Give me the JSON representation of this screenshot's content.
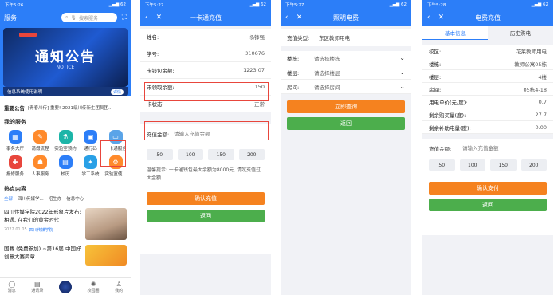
{
  "p1": {
    "time": "下午5:26",
    "signal": "▂▄▆ 62",
    "app_title": "服务",
    "search_placeholder": "搜索服务",
    "banner_title": "通知公告",
    "banner_subtitle": "NOTICE",
    "banner_caption": "信息系统使用说明",
    "banner_tag": "详情",
    "news_label": "重要公告",
    "news_text": "[青春川传] 重要! 2021级川传新生团员团...",
    "my_services_title": "我的服务",
    "services": [
      {
        "label": "事务大厅",
        "icon": "▦",
        "color": "#2c7ef8"
      },
      {
        "label": "请假流程",
        "icon": "✎",
        "color": "#ff8a2b"
      },
      {
        "label": "实验室预约",
        "icon": "⚗",
        "color": "#1cb5a8"
      },
      {
        "label": "通行码",
        "icon": "▣",
        "color": "#2c7ef8"
      },
      {
        "label": "一卡通服务",
        "icon": "▭",
        "color": "#5aa4e8"
      },
      {
        "label": "报修服务",
        "icon": "✚",
        "color": "#e8463c"
      },
      {
        "label": "人事服务",
        "icon": "☗",
        "color": "#ff8a2b"
      },
      {
        "label": "校历",
        "icon": "▤",
        "color": "#2c7ef8"
      },
      {
        "label": "学工系统",
        "icon": "✦",
        "color": "#29a0e6"
      },
      {
        "label": "实验室使...",
        "icon": "⚙",
        "color": "#ff8a2b"
      }
    ],
    "hot_title": "热点内容",
    "hot_tabs": [
      "全部",
      "四川传媒学...",
      "招生办",
      "信息中心"
    ],
    "article1_title": "四川传媒学院2022年形象片发布: 相遇, 在我们的黄金时代",
    "article1_date": "2022.01.05",
    "article1_source": "四川传媒学院",
    "article2_title": "国赛 (免费参加) ~第16届 中国好创意大赛简章",
    "bottom_nav": [
      {
        "label": "消息",
        "icon": "◯"
      },
      {
        "label": "通讯录",
        "icon": "▤"
      },
      {
        "label": "",
        "icon": "●"
      },
      {
        "label": "校园圈",
        "icon": "✺"
      },
      {
        "label": "我的",
        "icon": "♙"
      }
    ]
  },
  "p2": {
    "time": "下午5:27",
    "signal": "▂▄▆ 62",
    "title": "一卡通充值",
    "rows": [
      {
        "label": "姓名:",
        "value": "杨铮强"
      },
      {
        "label": "学号:",
        "value": "310676"
      },
      {
        "label": "卡钱包余额:",
        "value": "1223.07"
      },
      {
        "label": "未领取余额:",
        "value": "150"
      },
      {
        "label": "卡状态:",
        "value": "正常"
      }
    ],
    "amount_label": "充值金额:",
    "amount_placeholder": "请输入充值金额",
    "chips": [
      "50",
      "100",
      "150",
      "200"
    ],
    "hint": "温馨提示: 一卡通钱包最大余额为8000元, 请勿充值过大金额",
    "confirm": "确认充值",
    "back": "返回"
  },
  "p3": {
    "time": "下午5:27",
    "signal": "▂▄▆ 62",
    "title": "照明电费",
    "type_label": "充值类型:",
    "type_value": "东区教师用电",
    "selects": [
      {
        "label": "楼栋:",
        "placeholder": "请选择楼栋"
      },
      {
        "label": "楼层:",
        "placeholder": "请选择楼层"
      },
      {
        "label": "房间:",
        "placeholder": "请选择房间"
      }
    ],
    "query": "立即查询",
    "back": "返回"
  },
  "p4": {
    "time": "下午5:28",
    "signal": "▂▄▆ 62",
    "title": "电费充值",
    "tabs": [
      "基本信息",
      "历史购电"
    ],
    "rows": [
      {
        "label": "校区:",
        "value": "花莱教师用电"
      },
      {
        "label": "楼栋:",
        "value": "教师公寓05栋"
      },
      {
        "label": "楼层:",
        "value": "4楼"
      },
      {
        "label": "房间:",
        "value": "05栋4-18"
      },
      {
        "label": "用电单价(元/度):",
        "value": "0.7"
      },
      {
        "label": "剩余购买量(度):",
        "value": "27.7"
      },
      {
        "label": "剩余补助电量(度):",
        "value": "0.00"
      }
    ],
    "amount_label": "充值金额:",
    "amount_placeholder": "请输入充值金额",
    "chips": [
      "50",
      "100",
      "150",
      "200"
    ],
    "confirm": "确认支付",
    "back": "返回"
  },
  "colors": {
    "primary": "#2c7ef8",
    "orange": "#f5821f",
    "green": "#4cae4c",
    "highlight": "#e8463c"
  }
}
